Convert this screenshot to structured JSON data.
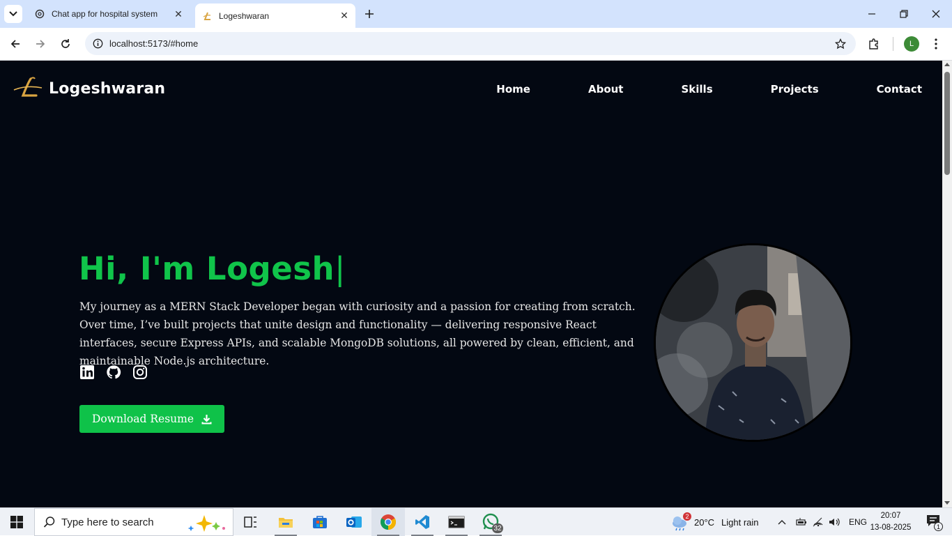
{
  "browser": {
    "tabs": [
      {
        "title": "Chat app for hospital system",
        "active": false
      },
      {
        "title": "Logeshwaran",
        "active": true
      }
    ],
    "url": "localhost:5173/#home",
    "profile_initial": "L"
  },
  "site": {
    "brand_name": "Logeshwaran",
    "nav": [
      "Home",
      "About",
      "Skills",
      "Projects",
      "Contact"
    ],
    "hero": {
      "title": "Hi, I'm Logesh",
      "caret": "|",
      "description": "My journey as a MERN Stack Developer began with curiosity and a passion for creating from scratch. Over time, I’ve built projects that unite design and functionality — delivering responsive React interfaces, secure Express APIs, and scalable MongoDB solutions, all powered by clean, efficient, and maintainable Node.js architecture.",
      "socials": [
        "linkedin-icon",
        "github-icon",
        "instagram-icon"
      ],
      "resume_button": "Download Resume"
    },
    "colors": {
      "accent": "#0fc249",
      "background": "#030812",
      "brand_gold": "#d9a441"
    }
  },
  "taskbar": {
    "search_placeholder": "Type here to search",
    "weather": {
      "temp": "20°C",
      "condition": "Light rain",
      "alert_count": "2"
    },
    "language": "ENG",
    "time": "20:07",
    "date": "13-08-2025",
    "whatsapp_badge": "32",
    "notification_count": "1"
  }
}
